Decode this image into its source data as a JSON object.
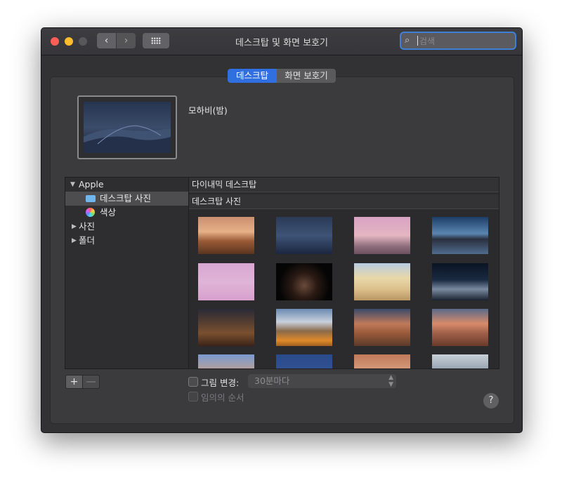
{
  "window": {
    "title": "데스크탑 및 화면 보호기",
    "back_glyph": "‹",
    "forward_glyph": "›",
    "search_placeholder": "검색"
  },
  "tabs": [
    {
      "label": "데스크탑",
      "selected": true
    },
    {
      "label": "화면 보호기",
      "selected": false
    }
  ],
  "current_wallpaper": {
    "name": "모하비(밤)"
  },
  "sidebar": {
    "apple_label": "Apple",
    "desktop_photos_label": "데스크탑 사진",
    "colors_label": "색상",
    "photos_label": "사진",
    "folders_label": "폴더"
  },
  "content": {
    "dynamic_header": "다이내믹 데스크탑",
    "photos_header": "데스크탑 사진"
  },
  "footer": {
    "add_label": "+",
    "remove_label": "—",
    "change_picture_label": "그림 변경:",
    "interval_value": "30분마다",
    "random_order_label": "임의의 순서",
    "help_label": "?"
  },
  "colors": {
    "accent": "#2f6fe0",
    "selection": "#4d4d50"
  }
}
